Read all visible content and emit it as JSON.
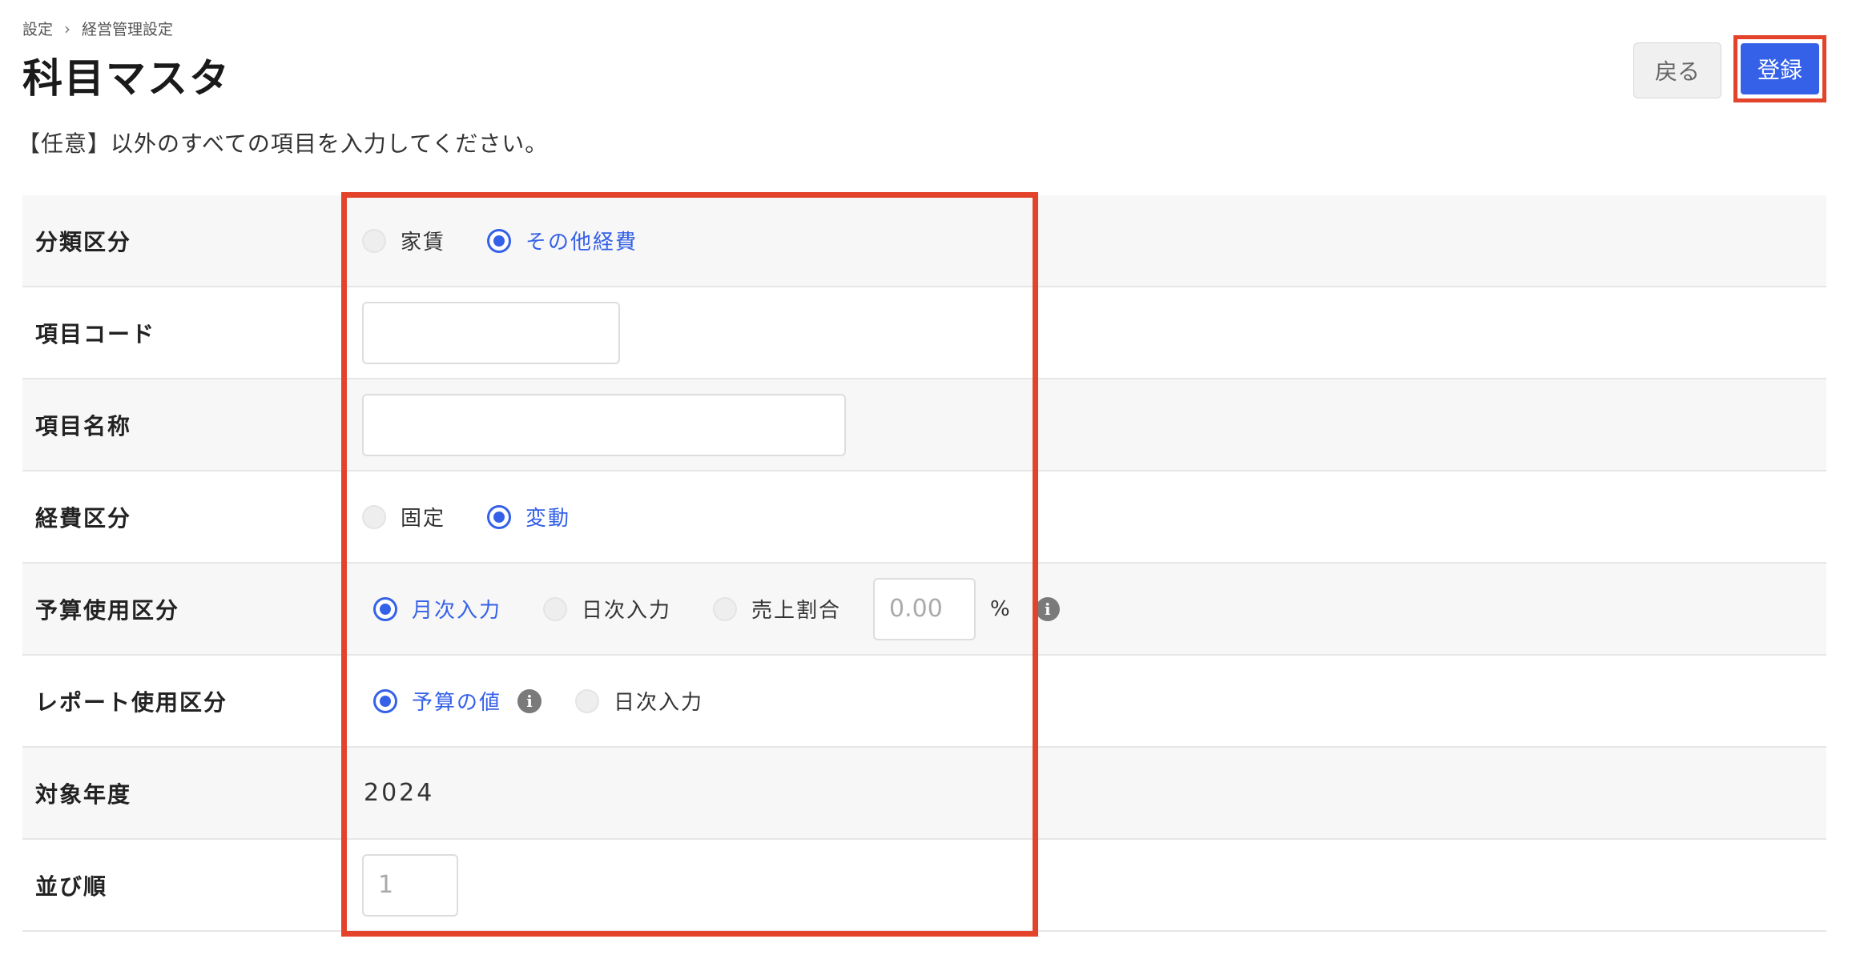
{
  "breadcrumb": {
    "items": [
      "設定",
      "経営管理設定"
    ],
    "separator": "›"
  },
  "page_title": "科目マスタ",
  "header": {
    "back_label": "戻る",
    "register_label": "登録"
  },
  "instruction": "【任意】以外のすべての項目を入力してください。",
  "form": {
    "category": {
      "label": "分類区分",
      "options": [
        "家賃",
        "その他経費"
      ],
      "selected": "その他経費"
    },
    "item_code": {
      "label": "項目コード",
      "value": ""
    },
    "item_name": {
      "label": "項目名称",
      "value": ""
    },
    "expense_type": {
      "label": "経費区分",
      "options": [
        "固定",
        "変動"
      ],
      "selected": "変動"
    },
    "budget_usage": {
      "label": "予算使用区分",
      "options": [
        "月次入力",
        "日次入力",
        "売上割合"
      ],
      "selected": "月次入力",
      "ratio_placeholder": "0.00",
      "ratio_unit": "%"
    },
    "report_usage": {
      "label": "レポート使用区分",
      "options": [
        "予算の値",
        "日次入力"
      ],
      "selected": "予算の値"
    },
    "target_year": {
      "label": "対象年度",
      "value": "2024"
    },
    "sort_order": {
      "label": "並び順",
      "placeholder": "1"
    }
  },
  "icons": {
    "info": "i"
  },
  "colors": {
    "accent": "#3561e8",
    "highlight": "#e3432b",
    "row_gray": "#f7f7f7"
  }
}
